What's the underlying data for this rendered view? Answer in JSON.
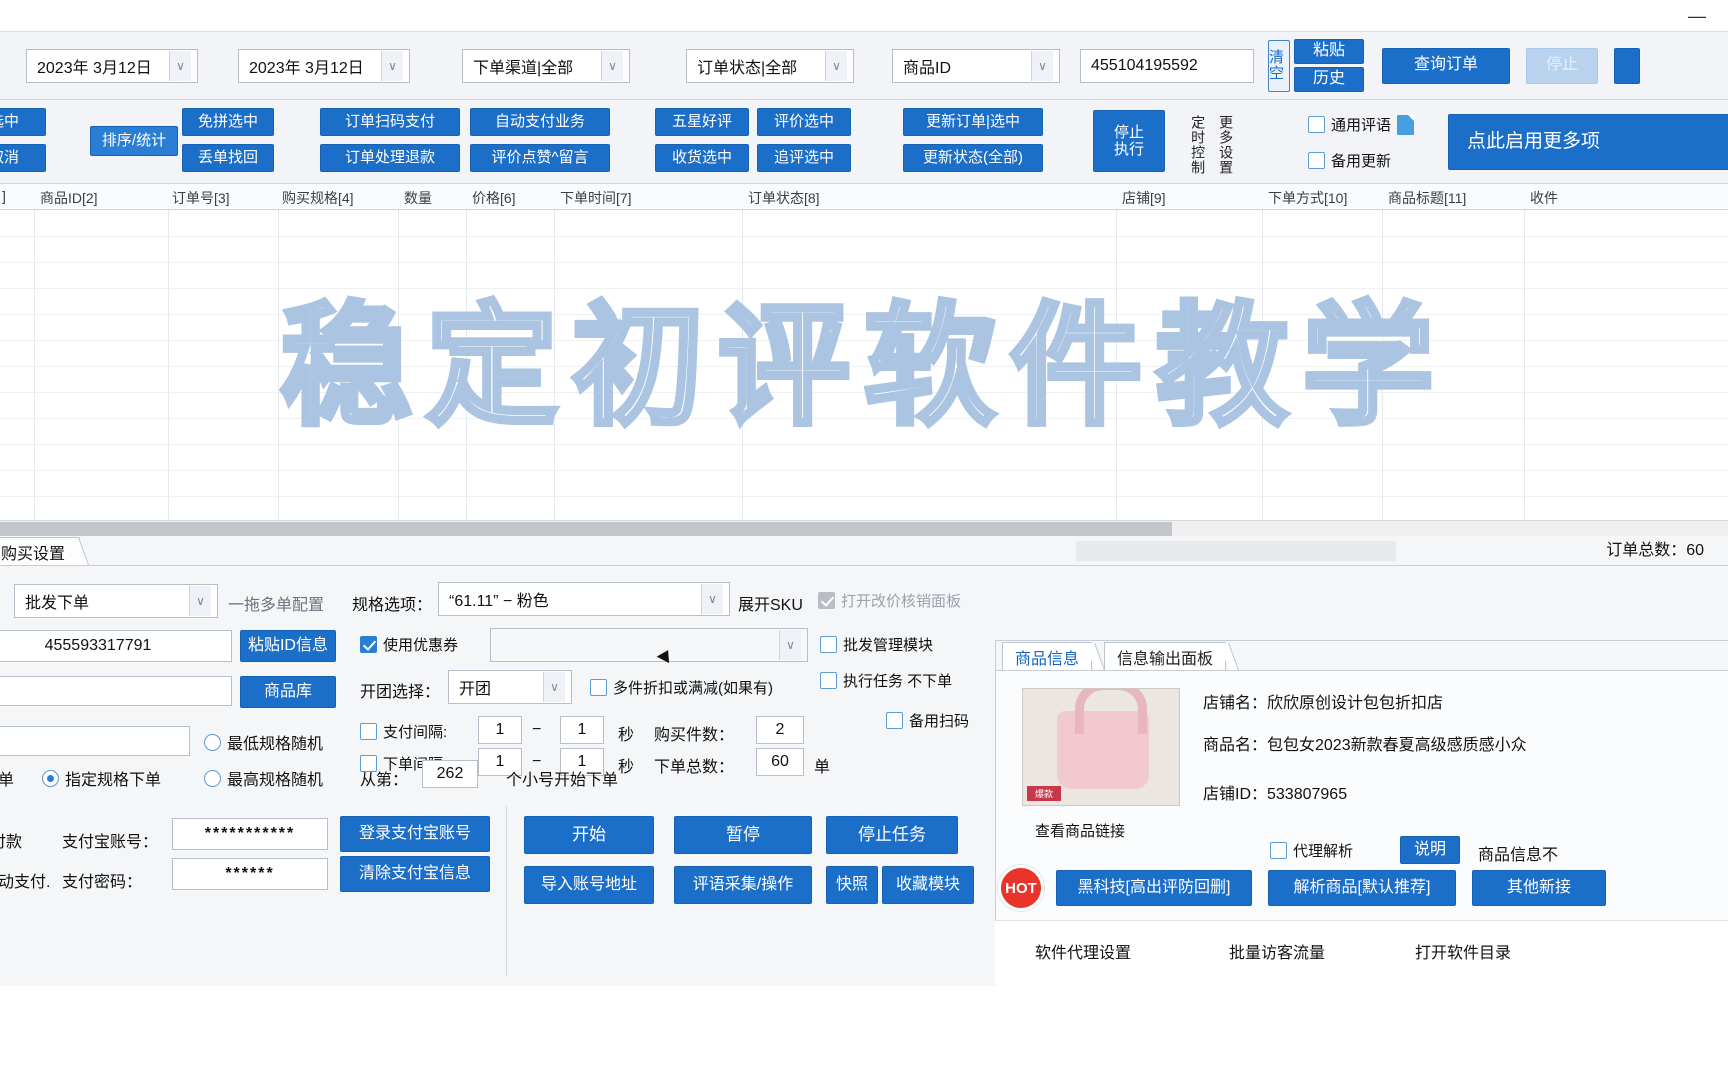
{
  "titlebar": {
    "minimize": "—"
  },
  "query": {
    "date_from": "2023年 3月12日",
    "date_to": "2023年 3月12日",
    "channel": "下单渠道|全部",
    "status": "订单状态|全部",
    "idtype": "商品ID",
    "idvalue": "455104195592",
    "clear": "清空",
    "paste": "粘贴",
    "history": "历史",
    "search": "查询订单",
    "stop": "停止"
  },
  "toolbar": {
    "select_partial": "选中",
    "cancel_partial": "取消",
    "sort_stats": "排序/统计",
    "free_group_selected": "免拼选中",
    "lost_order_find": "丢单找回",
    "order_scan_pay": "订单扫码支付",
    "order_refund": "订单处理退款",
    "auto_pay_service": "自动支付业务",
    "rate_like_message": "评价点赞^留言",
    "five_star": "五星好评",
    "receive_selected": "收货选中",
    "rate_selected": "评价选中",
    "followup_selected": "追评选中",
    "update_order_selected": "更新订单|选中",
    "update_status_all": "更新状态(全部)",
    "stop_exec": "停止\n执行",
    "timer_control": "定时控制",
    "more_settings": "更多设置",
    "general_comment": "通用评语",
    "backup_update": "备用更新",
    "enable_more": "点此启用更多项"
  },
  "grid": {
    "columns": [
      "]",
      "商品ID[2]",
      "订单号[3]",
      "购买规格[4]",
      "数量",
      "价格[6]",
      "下单时间[7]",
      "订单状态[8]",
      "店铺[9]",
      "下单方式[10]",
      "商品标题[11]",
      "收件"
    ],
    "watermark": "稳定初评软件教学"
  },
  "tabs": {
    "purchase_settings": "购买设置",
    "order_total_label": "订单总数：60"
  },
  "purchase": {
    "mode": "批发下单",
    "mode_hint": "一拖多单配置",
    "item_id": "455593317791",
    "paste_id_btn": "粘贴ID信息",
    "product_lib_btn": "商品库",
    "spec_label": "规格选项：",
    "spec_value": "“61.11” − 粉色",
    "expand_sku": "展开SKU",
    "open_price_panel": "打开改价核销面板",
    "use_coupon": "使用优惠券",
    "coupon_value": "",
    "group_label": "开团选择：",
    "group_value": "开团",
    "multi_discount": "多件折扣或满减(如果有)",
    "pay_interval": "支付间隔:",
    "pay_interval_min": "1",
    "pay_interval_max": "1",
    "pay_interval_unit": "秒",
    "buy_count_label": "购买件数：",
    "buy_count": "2",
    "order_interval": "下单间隔:",
    "order_interval_min": "1",
    "order_interval_max": "1",
    "order_interval_unit": "秒",
    "order_total_label": "下单总数：",
    "order_total": "60",
    "order_total_unit": "单",
    "lowest_spec_random": "最低规格随机",
    "highest_spec_random": "最高规格随机",
    "specified_spec_order": "指定规格下单",
    "order_word": "单",
    "from_label": "从第：",
    "from_value": "262",
    "from_suffix": "个小号开始下单",
    "batch_manage": "批发管理模块",
    "exec_task_no_order": "执行任务 不下单",
    "backup_scan": "备用扫码"
  },
  "payment": {
    "pay_label": "付款",
    "alipay_account_label": "支付宝账号：",
    "alipay_account": "***********",
    "auto_pay_label": "自动支付.",
    "alipay_pwd_label": "支付密码：",
    "alipay_pwd": "******",
    "login_alipay_btn": "登录支付宝账号",
    "clear_alipay_btn": "清除支付宝信息"
  },
  "actions": {
    "start": "开始",
    "pause": "暂停",
    "stop_task": "停止任务",
    "import_addr": "导入账号地址",
    "comment_collect": "评语采集/操作",
    "snapshot": "快照",
    "favorite_module": "收藏模块"
  },
  "product": {
    "tab_info": "商品信息",
    "tab_output": "信息输出面板",
    "shop_name_label": "店铺名：欣欣原创设计包包折扣店",
    "product_name_label": "商品名：包包女2023新款春夏高级感质感小众",
    "shop_id_label": "店铺ID：533807965",
    "view_link": "查看商品链接",
    "agent_parse": "代理解析",
    "explain_btn": "说明",
    "info_right_text": "商品信息不",
    "hot_badge": "HOT",
    "blackteck_btn": "黑科技[高出评防回删]",
    "parse_product_btn": "解析商品[默认推荐]",
    "other_new_btn": "其他新接",
    "agent_settings": "软件代理设置",
    "batch_traffic": "批量访客流量",
    "open_dir": "打开软件目录",
    "tag_promo": "爆款"
  }
}
